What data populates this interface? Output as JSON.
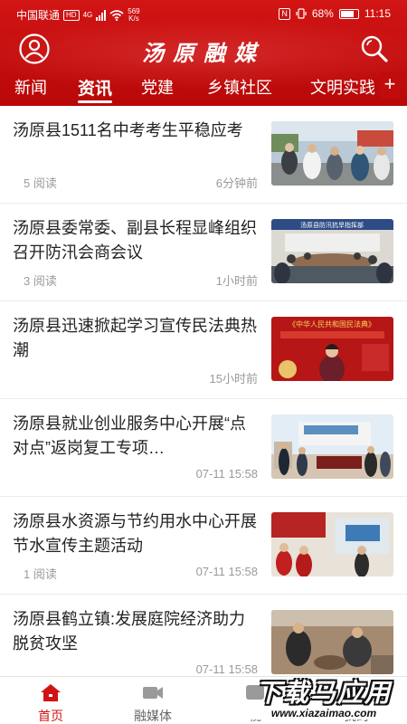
{
  "status_bar": {
    "carrier": "中国联通",
    "hd": "HD",
    "network": "4G",
    "speed_value": "569",
    "speed_unit": "K/s",
    "nfc": "N",
    "battery_percent": "68%",
    "time": "11:15"
  },
  "header": {
    "app_title": "汤原融媒",
    "user_icon": "user-circle-icon",
    "search_icon": "search-icon"
  },
  "tabs": [
    {
      "label": "新闻",
      "active": false
    },
    {
      "label": "资讯",
      "active": true
    },
    {
      "label": "党建",
      "active": false
    },
    {
      "label": "乡镇社区",
      "active": false
    },
    {
      "label": "文明实践",
      "active": false
    }
  ],
  "tab_add_label": "+",
  "news": [
    {
      "title": "汤原县1511名中考考生平稳应考",
      "reads": "5 阅读",
      "time": "6分钟前"
    },
    {
      "title": "汤原县委常委、副县长程显峰组织召开防汛会商会议",
      "reads": "3 阅读",
      "time": "1小时前"
    },
    {
      "title": "汤原县迅速掀起学习宣传民法典热潮",
      "reads": "",
      "time": "15小时前"
    },
    {
      "title": "汤原县就业创业服务中心开展“点对点”返岗复工专项…",
      "reads": "",
      "time": "07-11 15:58"
    },
    {
      "title": "汤原县水资源与节约用水中心开展节水宣传主题活动",
      "reads": "1 阅读",
      "time": "07-11 15:58"
    },
    {
      "title": "汤原县鹤立镇:发展庭院经济助力脱贫攻坚",
      "reads": "",
      "time": "07-11 15:58"
    }
  ],
  "thumb_texts": {
    "item2_banner": "汤原县防汛抗旱指挥部",
    "item3_banner": "《中华人民共和国民法典》"
  },
  "bottom_nav": [
    {
      "label": "首页",
      "icon": "home-icon",
      "active": true
    },
    {
      "label": "融媒体",
      "icon": "video-camera-icon",
      "active": false
    },
    {
      "label": "视",
      "icon": "media-icon",
      "active": false
    },
    {
      "label": "我的",
      "icon": "profile-icon",
      "active": false
    }
  ],
  "watermark": {
    "main": "下载马应用",
    "sub": "www.xiazaimao.com"
  },
  "colors": {
    "brand_red": "#c30d0d",
    "text": "#222222",
    "meta": "#9a9a9a",
    "active_nav": "#d01414"
  }
}
